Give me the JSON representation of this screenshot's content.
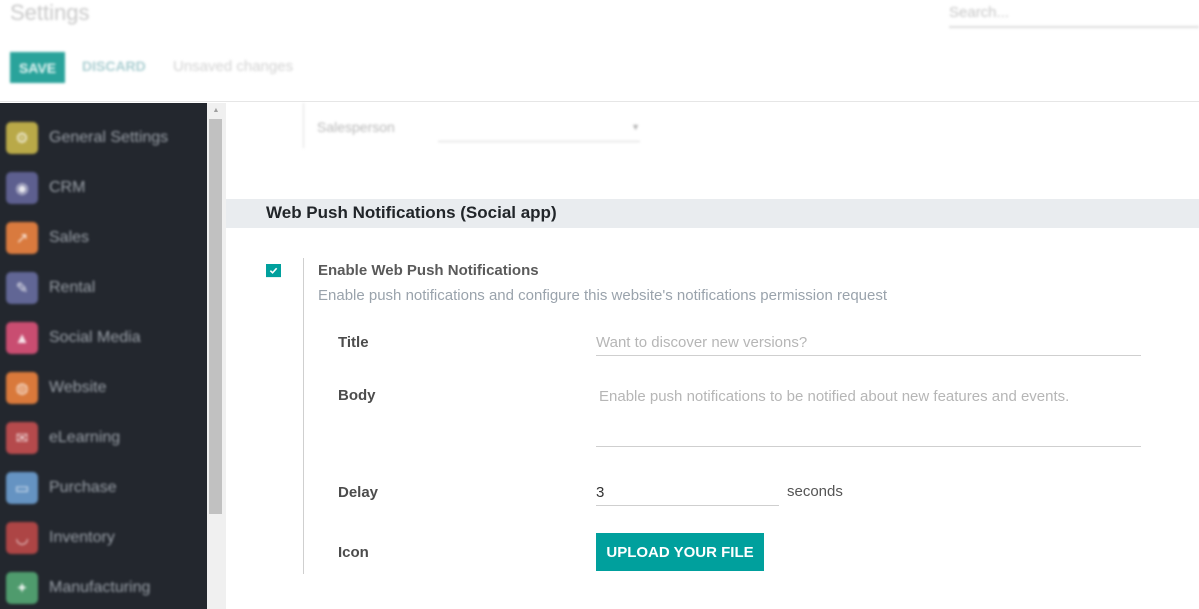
{
  "control_panel": {
    "breadcrumb": "Settings",
    "search_placeholder": "Search...",
    "save_label": "SAVE",
    "discard_label": "DISCARD",
    "status_text": "Unsaved changes"
  },
  "sidebar": {
    "items": [
      {
        "label": "General Settings",
        "icon": "gear-icon",
        "glyph": "⚙",
        "color": "#b9a948"
      },
      {
        "label": "CRM",
        "icon": "handshake-icon",
        "glyph": "◉",
        "color": "#5d5f8f"
      },
      {
        "label": "Sales",
        "icon": "chart-line-icon",
        "glyph": "↗",
        "color": "#d97a3e"
      },
      {
        "label": "Rental",
        "icon": "rental-icon",
        "glyph": "✎",
        "color": "#616695"
      },
      {
        "label": "Social Media",
        "icon": "thumbs-up-icon",
        "glyph": "▲",
        "color": "#c94d71"
      },
      {
        "label": "Website",
        "icon": "globe-icon",
        "glyph": "◍",
        "color": "#d9793b"
      },
      {
        "label": "eLearning",
        "icon": "chat-icon",
        "glyph": "✉",
        "color": "#b54a4c"
      },
      {
        "label": "Purchase",
        "icon": "credit-card-icon",
        "glyph": "▭",
        "color": "#6593c2"
      },
      {
        "label": "Inventory",
        "icon": "box-icon",
        "glyph": "◡",
        "color": "#ad4545"
      },
      {
        "label": "Manufacturing",
        "icon": "wrench-icon",
        "glyph": "✦",
        "color": "#4f9b6d"
      }
    ]
  },
  "content": {
    "salesperson_label": "Salesperson",
    "salesperson_value": "",
    "section_title": "Web Push Notifications (Social app)",
    "setting": {
      "enabled": true,
      "title": "Enable Web Push Notifications",
      "description": "Enable push notifications and configure this website's notifications permission request",
      "fields": {
        "title_label": "Title",
        "title_value": "",
        "title_placeholder": "Want to discover new versions?",
        "body_label": "Body",
        "body_value": "",
        "body_placeholder": "Enable push notifications to be notified about new features and events.",
        "delay_label": "Delay",
        "delay_value": "3",
        "delay_unit": "seconds",
        "icon_label": "Icon",
        "upload_label": "UPLOAD YOUR FILE"
      }
    }
  },
  "colors": {
    "accent": "#00a09d",
    "sidebar_bg": "#23272e",
    "section_bg": "#e9ecef"
  }
}
